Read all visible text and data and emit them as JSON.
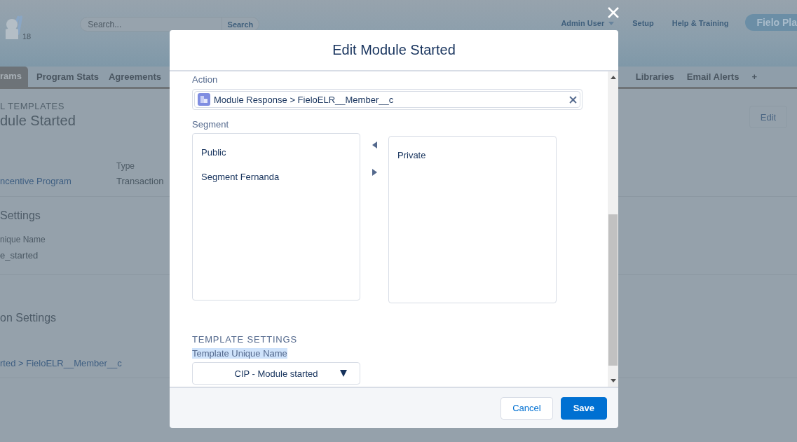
{
  "page": {
    "header": {
      "notification_count": "18",
      "search": {
        "placeholder": "Search...",
        "button": "Search"
      },
      "links": [
        {
          "label": "Admin User",
          "kind": "menu"
        },
        {
          "label": "Setup",
          "kind": "link"
        },
        {
          "label": "Help & Training",
          "kind": "link"
        }
      ],
      "app_button": "Fielo Pla"
    },
    "tabs": [
      {
        "label": "rams",
        "selected": true
      },
      {
        "label": "Program Stats",
        "selected": false
      },
      {
        "label": "Agreements",
        "selected": false
      }
    ],
    "tabs_right": [
      {
        "label": "Libraries",
        "selected": false
      },
      {
        "label": "Email Alerts",
        "selected": false
      },
      {
        "label": "+",
        "selected": false
      }
    ],
    "breadcrumb": "L TEMPLATES",
    "title": "dule Started",
    "edit_button": "Edit",
    "fields": [
      {
        "kind": "link",
        "value": "ncentive Program"
      },
      {
        "kind": "text",
        "label": "Type",
        "value": "Transaction"
      }
    ],
    "sections": [
      {
        "heading": "Settings",
        "fields": [
          {
            "kind": "text",
            "label": "nique Name",
            "value": "e_started"
          }
        ]
      },
      {
        "heading": "on Settings",
        "fields": [
          {
            "kind": "link",
            "value": "rted > FieloELR__Member__c"
          }
        ]
      }
    ]
  },
  "modal": {
    "title": "Edit Module Started",
    "fields": [
      {
        "kind": "lookup",
        "label": "Action",
        "value": "Module Response > FieloELR__Member__c"
      },
      {
        "kind": "dual_list",
        "label": "Segment",
        "available": [
          {
            "label": "Public",
            "selected": false
          },
          {
            "label": "Segment Fernanda",
            "selected": false
          }
        ],
        "chosen": [
          {
            "label": "Private",
            "selected": false
          }
        ]
      }
    ],
    "section": "TEMPLATE SETTINGS",
    "template_field": {
      "label": "Template Unique Name",
      "highlighted": true,
      "value": "CIP - Module started"
    },
    "buttons": [
      {
        "label": "Cancel",
        "kind": "neutral"
      },
      {
        "label": "Save",
        "kind": "brand"
      }
    ]
  }
}
